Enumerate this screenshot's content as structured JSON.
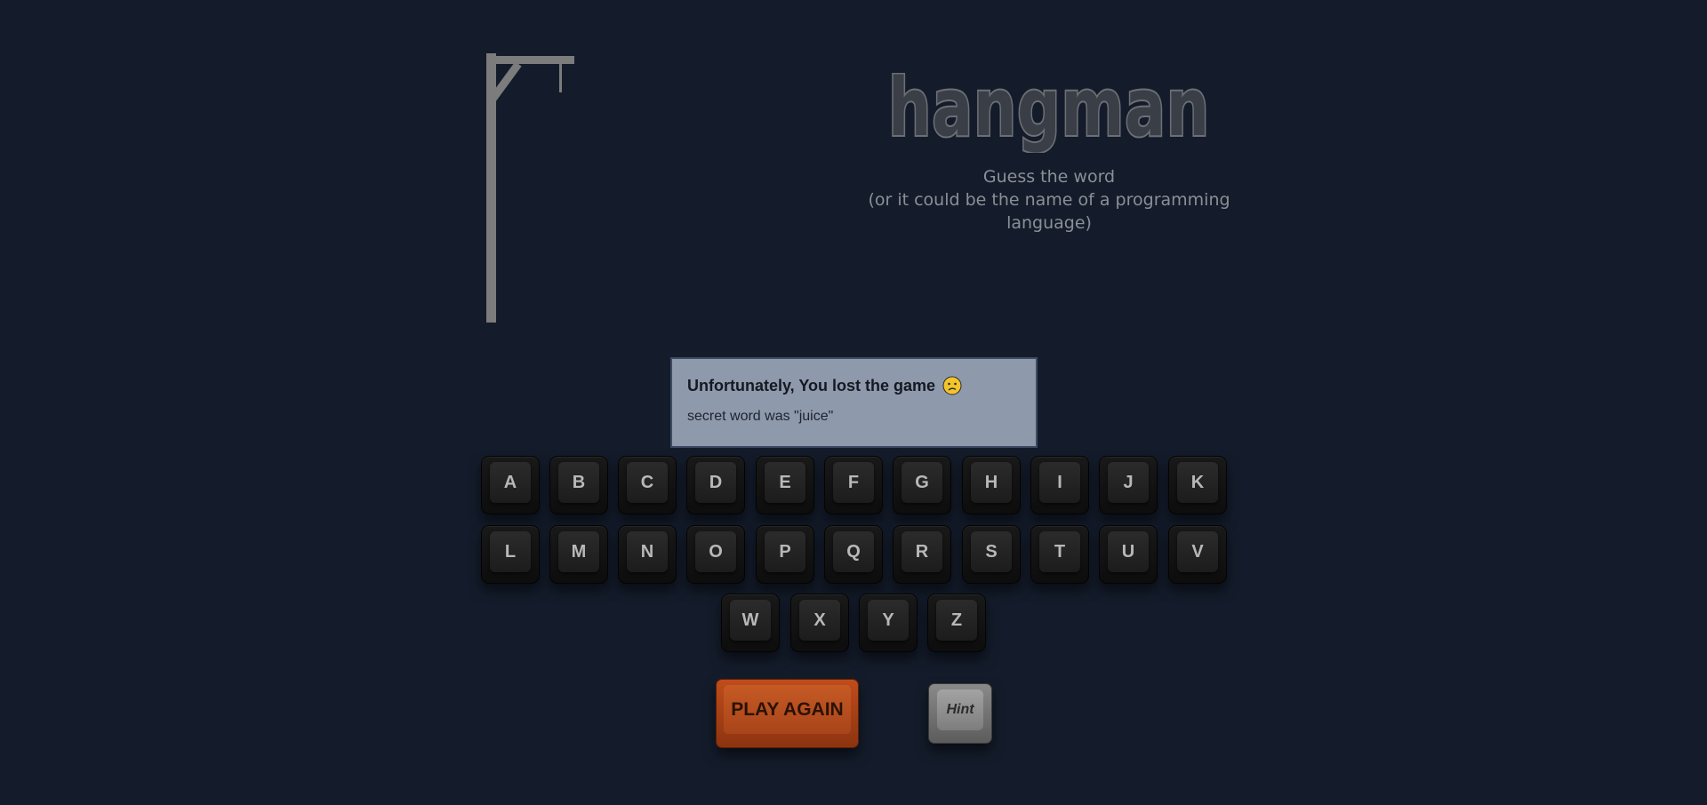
{
  "game": {
    "title": "hangman",
    "subtitle_line1": "Guess the word",
    "subtitle_line2": "(or it could be the name of a programming language)",
    "gallows_icon": "gallows-icon"
  },
  "message": {
    "title": "Unfortunately, You lost the game",
    "emoji": "worried-face-icon",
    "detail": "secret word was \"juice\""
  },
  "keyboard": {
    "row1": [
      "A",
      "B",
      "C",
      "D",
      "E",
      "F",
      "G",
      "H",
      "I",
      "J",
      "K"
    ],
    "row2": [
      "L",
      "M",
      "N",
      "O",
      "P",
      "Q",
      "R",
      "S",
      "T",
      "U",
      "V"
    ],
    "row3": [
      "W",
      "X",
      "Y",
      "Z"
    ]
  },
  "controls": {
    "play_again_label": "PLAY AGAIN",
    "hint_label": "Hint"
  },
  "colors": {
    "background": "#141c2b",
    "message_bg": "#8e99ab",
    "play_again": "#b5461a",
    "key": "#1a1a1a",
    "hint": "#8a8a8a"
  }
}
